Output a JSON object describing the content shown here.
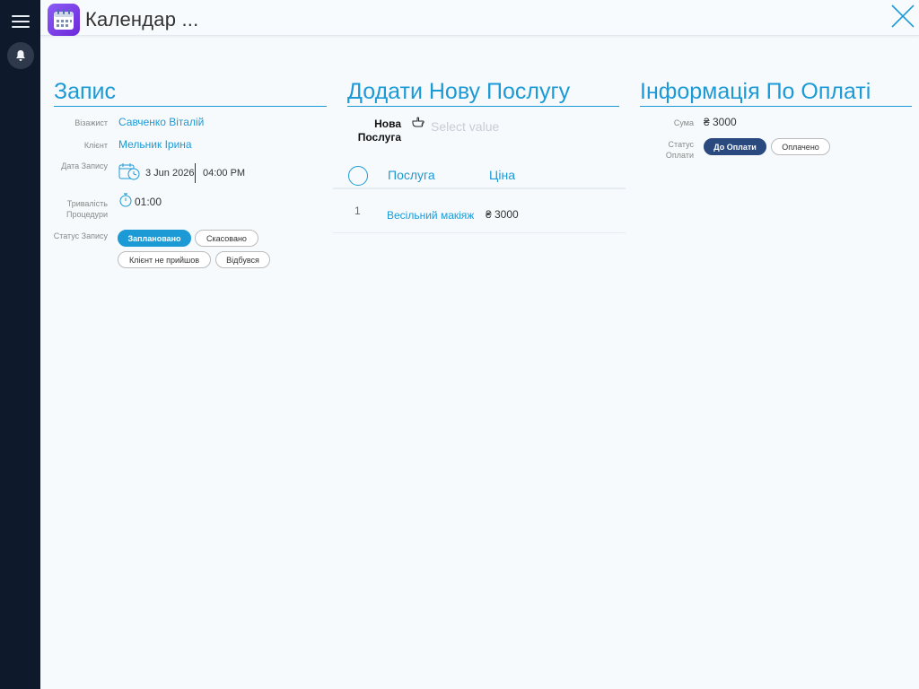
{
  "header": {
    "title": "Календар ..."
  },
  "booking": {
    "title": "Запис",
    "stylist_label": "Візажист",
    "stylist_value": "Савченко Віталій",
    "client_label": "Клієнт",
    "client_value": "Мельник Ірина",
    "date_label": "Дата Запису",
    "date_value": "3 Jun 2026",
    "time_value": "04:00 PM",
    "duration_label": "Тривалість Процедури",
    "duration_value": "01:00",
    "status_label": "Статус Запису",
    "status_options": [
      "Заплановано",
      "Скасовано",
      "Клієнт не прийшов",
      "Відбувся"
    ],
    "status_selected": "Заплановано"
  },
  "service": {
    "title": "Додати Нову Послугу",
    "new_label": "Нова Послуга",
    "select_placeholder": "Select value",
    "columns": {
      "service": "Послуга",
      "price": "Ціна"
    },
    "rows": [
      {
        "index": "1",
        "service": "Весільний макіяж",
        "price": "₴ 3000"
      }
    ]
  },
  "payment": {
    "title": "Інформація По Оплаті",
    "sum_label": "Сума",
    "sum_value": "₴ 3000",
    "status_label": "Статус Оплати",
    "status_options": [
      "До Оплати",
      "Оплачено"
    ],
    "status_selected": "До Оплати"
  },
  "colors": {
    "accent": "#1c9ad6",
    "sidebar": "#0e1a2b",
    "navy": "#2a4a7f"
  }
}
